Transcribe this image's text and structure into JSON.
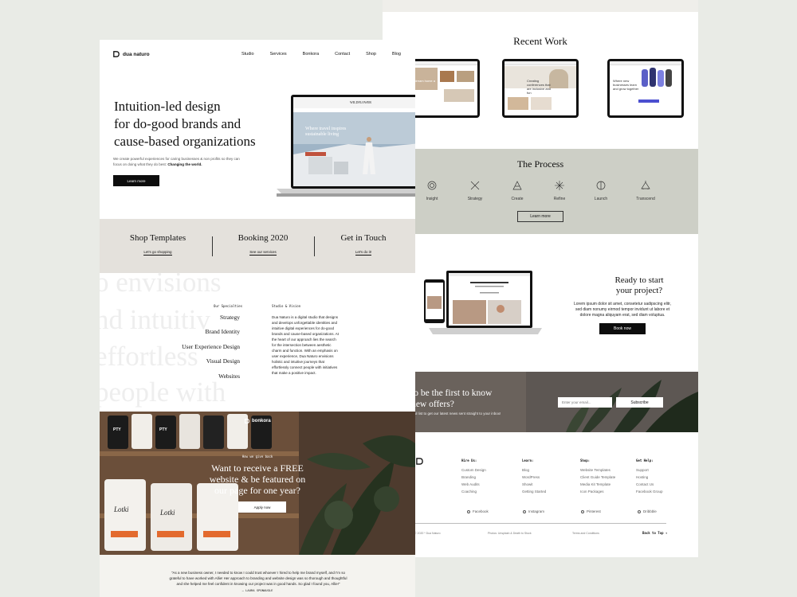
{
  "left": {
    "logo": "dua naturo",
    "nav": [
      "Studio",
      "Services",
      "Bonkora",
      "Contact",
      "Shop",
      "Blog"
    ],
    "hero": {
      "title_lines": [
        "Intuition-led design",
        "for do-good brands and",
        "cause-based organizations"
      ],
      "text": "We create powerful experiences for caring businesses & non profits so they can focus on doing what they do best:",
      "text_bold": "Changing the world.",
      "button": "Learn more",
      "screen_headline": "Where travel inspires sustainable living",
      "screen_brand": "WILDFLOWER"
    },
    "shop_band": [
      {
        "title": "Shop Templates",
        "link": "Let's go shopping"
      },
      {
        "title": "Booking 2020",
        "link": "See our services"
      },
      {
        "title": "Get in Touch",
        "link": "Let's do it!"
      }
    ],
    "background_words": [
      "o envisions",
      "nd intuitiv",
      "effortless",
      "people with"
    ],
    "specialties": {
      "label": "Our Specialties",
      "items": [
        "Strategy",
        "Brand Identity",
        "User Experience Design",
        "Visual Design",
        "Websites"
      ]
    },
    "studio": {
      "label": "Studio & Vision",
      "text": "Dua Naturo is a digital studio that designs and develops unforgettable identities and intuitive digital experiences for do-good brands and cause-based organizations. At the heart of our approach lies the search for the intersection between aesthetic charm and function. With an emphasis on user experience, Dua Naturo envisions holistic and intuitive journeys that effortlessly connect people with initiatives that make a positive impact."
    },
    "bonkora": {
      "logo": "bonkora",
      "kicker": "How we give back",
      "title_lines": [
        "Want to receive a FREE",
        "website & be featured on",
        "our page for one year?"
      ],
      "button": "Apply now",
      "bag_labels": [
        "PTY",
        "PTY",
        "Lotki",
        "Lotki"
      ]
    },
    "testimonial": {
      "quote": "\"As a new business owner, I needed to know I could trust whoever I hired to help me brand myself, and I'm so grateful to have worked with Allie! Her approach to branding and website design was so thorough and thoughtful and she helped me feel confident in knowing our project was in good hands. So glad I found you, Allie!\"",
      "author": "— LAURA SPONAUGLE"
    }
  },
  "right": {
    "recent_work": {
      "title": "Recent Work",
      "thumb_texts": [
        "Your dream home a few",
        "Creating conferences that are inclusive and fun",
        "Where new businesses learn and grow together"
      ]
    },
    "process": {
      "title": "The Process",
      "steps": [
        "Insight",
        "Strategy",
        "Create",
        "Refine",
        "Launch",
        "Transcend"
      ],
      "button": "Learn more"
    },
    "ready": {
      "title_lines": [
        "Ready to start",
        "your project?"
      ],
      "text": "Lorem ipsum dolor sit amet, consetetur sadipscing elitr, sed diam nonumy eirmod tempor invidunt ut labore et dolore magna aliquyam erat, sed diam voluptua.",
      "button": "Book now"
    },
    "newsletter": {
      "title_lines": [
        "t to be the first to know",
        "t new offers?"
      ],
      "sub": "r email list to get our latest news sent straight to your inbox!",
      "placeholder": "Enter your email...",
      "button": "Subscribe"
    },
    "footer": {
      "columns": [
        {
          "head": "Hire Us:",
          "items": [
            "Custom Design",
            "Branding",
            "Web Audits",
            "Coaching"
          ]
        },
        {
          "head": "Learn:",
          "items": [
            "Blog",
            "WordPress",
            "Showit",
            "Getting Started"
          ]
        },
        {
          "head": "Shop:",
          "items": [
            "Website Templates",
            "Client Guide Template",
            "Media Kit Template",
            "Icon Packages"
          ]
        },
        {
          "head": "Get Help:",
          "items": [
            "Support",
            "Hosting",
            "Contact Us",
            "Facebook Group"
          ]
        }
      ],
      "social": [
        "Facebook",
        "Instagram",
        "Pinterest",
        "Dribbble"
      ],
      "copyright": "© 2020 * Dua Naturo",
      "photo_credit": "Photos: Unsplash & Death to Stock",
      "terms": "Terms and Conditions",
      "back_top": "Back to Top ↑"
    }
  },
  "colors": {
    "background": "#e9ebe6",
    "process_band": "#cdcfc6",
    "shop_band": "#e4e1dc",
    "dark": "#0d0d0d"
  }
}
